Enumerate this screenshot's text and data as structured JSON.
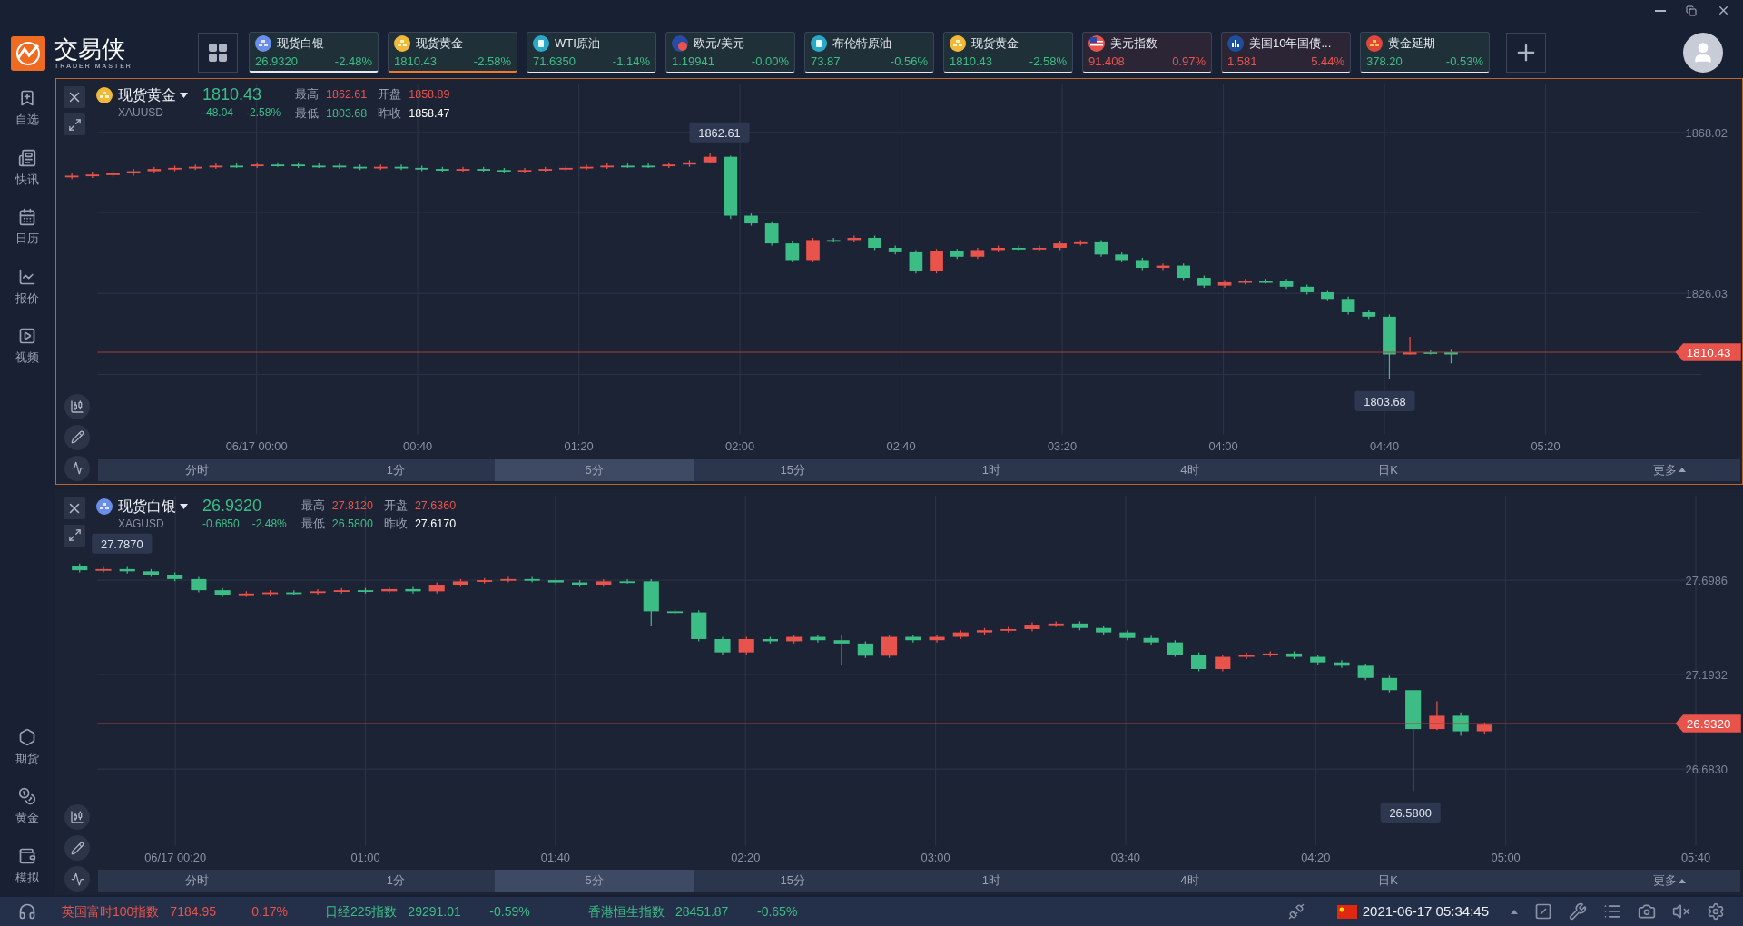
{
  "app": {
    "logo_text": "交易侠",
    "logo_subtitle": "TRADER MASTER"
  },
  "tickers": [
    {
      "kind": "silver",
      "name": "现货白银",
      "price": "26.9320",
      "change": "-2.48%",
      "rising": false,
      "selected": false,
      "open": true
    },
    {
      "kind": "gold",
      "name": "现货黄金",
      "price": "1810.43",
      "change": "-2.58%",
      "rising": false,
      "selected": true,
      "open": true
    },
    {
      "kind": "oil",
      "name": "WTI原油",
      "price": "71.6350",
      "change": "-1.14%",
      "rising": false,
      "selected": false,
      "open": false
    },
    {
      "kind": "fx",
      "name": "欧元/美元",
      "price": "1.19941",
      "change": "-0.00%",
      "rising": false,
      "selected": false,
      "open": false
    },
    {
      "kind": "oil",
      "name": "布伦特原油",
      "price": "73.87",
      "change": "-0.56%",
      "rising": false,
      "selected": false,
      "open": false
    },
    {
      "kind": "gold",
      "name": "现货黄金",
      "price": "1810.43",
      "change": "-2.58%",
      "rising": false,
      "selected": false,
      "open": false
    },
    {
      "kind": "usd",
      "name": "美元指数",
      "price": "91.408",
      "change": "0.97%",
      "rising": true,
      "selected": false,
      "open": false
    },
    {
      "kind": "bond",
      "name": "美国10年国债...",
      "price": "1.581",
      "change": "5.44%",
      "rising": true,
      "selected": false,
      "open": false
    },
    {
      "kind": "deferred",
      "name": "黄金延期",
      "price": "378.20",
      "change": "-0.53%",
      "rising": false,
      "selected": false,
      "open": false
    }
  ],
  "sidebar": {
    "top": [
      {
        "kind": "watchlist",
        "label": "自选"
      },
      {
        "kind": "news",
        "label": "快讯"
      },
      {
        "kind": "calendar",
        "label": "日历"
      },
      {
        "kind": "quotes",
        "label": "报价"
      },
      {
        "kind": "video",
        "label": "视频"
      }
    ],
    "bottom": [
      {
        "kind": "futures",
        "label": "期货"
      },
      {
        "kind": "gold",
        "label": "黄金"
      },
      {
        "kind": "demo",
        "label": "模拟"
      }
    ]
  },
  "panels": [
    {
      "selected": true,
      "symbol": {
        "kind": "gold",
        "name": "现货黄金",
        "code": "XAUUSD"
      },
      "price": "1810.43",
      "rising": false,
      "change": "-48.04",
      "change_pct": "-2.58%",
      "stats": [
        {
          "label": "最高",
          "value": "1862.61",
          "color": "#e8534b"
        },
        {
          "label": "开盘",
          "value": "1858.89",
          "color": "#e8534b"
        },
        {
          "label": "最低",
          "value": "1803.68",
          "color": "#3dbd86"
        },
        {
          "label": "昨收",
          "value": "1858.47",
          "color": "#ffffff"
        }
      ],
      "yticks": [
        "1868.02",
        "1826.03"
      ],
      "current": "1810.43",
      "marks": [
        "1862.61",
        "1803.68"
      ],
      "xticks": [
        "06/17 00:00",
        "00:40",
        "01:20",
        "02:00",
        "02:40",
        "03:20",
        "04:00",
        "04:40",
        "05:20"
      ],
      "periods": [
        {
          "label": "分时",
          "selected": false
        },
        {
          "label": "1分",
          "selected": false
        },
        {
          "label": "5分",
          "selected": true
        },
        {
          "label": "15分",
          "selected": false
        },
        {
          "label": "1时",
          "selected": false
        },
        {
          "label": "4时",
          "selected": false
        },
        {
          "label": "日K",
          "selected": false
        }
      ],
      "more": "更多"
    },
    {
      "selected": false,
      "symbol": {
        "kind": "silver",
        "name": "现货白银",
        "code": "XAGUSD"
      },
      "price": "26.9320",
      "rising": false,
      "change": "-0.6850",
      "change_pct": "-2.48%",
      "stats": [
        {
          "label": "最高",
          "value": "27.8120",
          "color": "#e8534b"
        },
        {
          "label": "开盘",
          "value": "27.6360",
          "color": "#e8534b"
        },
        {
          "label": "最低",
          "value": "26.5800",
          "color": "#3dbd86"
        },
        {
          "label": "昨收",
          "value": "27.6170",
          "color": "#ffffff"
        }
      ],
      "yticks": [
        "27.6986",
        "27.1932",
        "26.6830"
      ],
      "current": "26.9320",
      "marks": [
        "27.7870",
        "26.5800"
      ],
      "xticks": [
        "06/17 00:20",
        "01:00",
        "01:40",
        "02:20",
        "03:00",
        "03:40",
        "04:20",
        "05:00",
        "05:40"
      ],
      "periods": [
        {
          "label": "分时",
          "selected": false
        },
        {
          "label": "1分",
          "selected": false
        },
        {
          "label": "5分",
          "selected": true
        },
        {
          "label": "15分",
          "selected": false
        },
        {
          "label": "1时",
          "selected": false
        },
        {
          "label": "4时",
          "selected": false
        },
        {
          "label": "日K",
          "selected": false
        }
      ],
      "more": "更多"
    }
  ],
  "status_bar": {
    "indices": [
      {
        "name": "英国富时100指数",
        "price": "7184.95",
        "change": "0.17%",
        "rising": true
      },
      {
        "name": "日经225指数",
        "price": "29291.01",
        "change": "-0.59%",
        "rising": false
      },
      {
        "name": "香港恒生指数",
        "price": "28451.87",
        "change": "-0.65%",
        "rising": false
      }
    ],
    "datetime": "2021-06-17 05:34:45"
  }
}
